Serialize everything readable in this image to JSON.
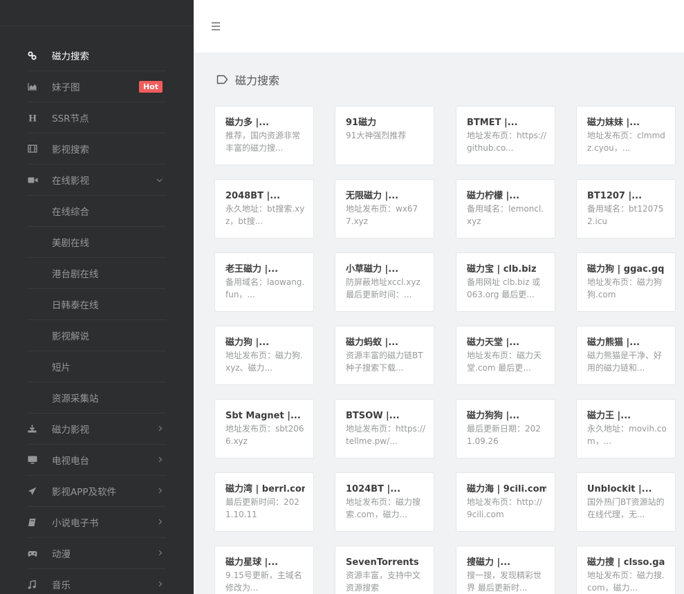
{
  "sidebar": {
    "items": [
      {
        "icon": "link-icon",
        "label": "磁力搜索",
        "active": true
      },
      {
        "icon": "area-chart-icon",
        "label": "妹子图",
        "badge": "Hot"
      },
      {
        "icon": "h-icon",
        "label": "SSR节点"
      },
      {
        "icon": "film-icon",
        "label": "影视搜索"
      },
      {
        "icon": "video-camera-icon",
        "label": "在线影视",
        "expanded": true
      },
      {
        "label": "在线综合",
        "sub": true
      },
      {
        "label": "美剧在线",
        "sub": true
      },
      {
        "label": "港台剧在线",
        "sub": true
      },
      {
        "label": "日韩泰在线",
        "sub": true
      },
      {
        "label": "影视解说",
        "sub": true
      },
      {
        "label": "短片",
        "sub": true
      },
      {
        "label": "资源采集站",
        "sub": true
      },
      {
        "icon": "download-icon",
        "label": "磁力影视",
        "arrow": true
      },
      {
        "icon": "monitor-icon",
        "label": "电视电台",
        "arrow": true
      },
      {
        "icon": "rocket-icon",
        "label": "影视APP及软件",
        "arrow": true
      },
      {
        "icon": "book-icon",
        "label": "小说电子书",
        "arrow": true
      },
      {
        "icon": "gamepad-icon",
        "label": "动漫",
        "arrow": true
      },
      {
        "icon": "music-icon",
        "label": "音乐",
        "arrow": true
      }
    ]
  },
  "header": {
    "menu_icon": "hamburger-icon"
  },
  "section": {
    "icon": "tag-icon",
    "title": "磁力搜索"
  },
  "cards": [
    {
      "title": "磁力多 |...",
      "desc": "推荐，国内资源非常丰富的磁力搜..."
    },
    {
      "title": "91磁力",
      "desc": "91大神强烈推荐"
    },
    {
      "title": "BTMET |...",
      "desc": "地址发布页：https://github.co..."
    },
    {
      "title": "磁力妹妹 |...",
      "desc": "地址发布页：clmmdz.cyou，..."
    },
    {
      "title": "2048BT |...",
      "desc": "永久地址：bt搜索.xyz，bt搜..."
    },
    {
      "title": "无限磁力 |...",
      "desc": "地址发布页：wx677.xyz"
    },
    {
      "title": "磁力柠檬 |...",
      "desc": "备用域名：lemoncl.xyz"
    },
    {
      "title": "BT1207 |...",
      "desc": "备用域名：bt120752.icu"
    },
    {
      "title": "老王磁力 |...",
      "desc": "备用域名：laowang.fun，..."
    },
    {
      "title": "小草磁力 |...",
      "desc": "防屏蔽地址xccl.xyz 最后更新时间：..."
    },
    {
      "title": "磁力宝 | clb.biz",
      "desc": "备用网址 clb.biz 或 063.org 最后更..."
    },
    {
      "title": "磁力狗 | ggac.gq",
      "desc": "地址发布页：磁力狗狗.com"
    },
    {
      "title": "磁力狗 |...",
      "desc": "地址发布页：磁力狗.xyz、磁力..."
    },
    {
      "title": "磁力蚂蚁 |...",
      "desc": "资源丰富的磁力链BT种子搜索下载..."
    },
    {
      "title": "磁力天堂 |...",
      "desc": "地址发布页：磁力天堂.com 最后更..."
    },
    {
      "title": "磁力熊猫 |...",
      "desc": "磁力熊猫是干净、好用的磁力链和..."
    },
    {
      "title": "Sbt Magnet |...",
      "desc": "地址发布页：sbt2066.xyz"
    },
    {
      "title": "BTSOW |...",
      "desc": "地址发布页：https://tellme.pw/..."
    },
    {
      "title": "磁力狗狗 |...",
      "desc": "最后更新日期：2021.09.26"
    },
    {
      "title": "磁力王 |...",
      "desc": "永久地址：movih.com，..."
    },
    {
      "title": "磁力湾 | berrl.com",
      "desc": "最后更新时间：2021.10.11"
    },
    {
      "title": "1024BT |...",
      "desc": "地址发布页：磁力搜索.com，磁力..."
    },
    {
      "title": "磁力海 | 9cili.com",
      "desc": "地址发布页：http://9cili.com"
    },
    {
      "title": "Unblockit |...",
      "desc": "国外热门BT资源站的在线代理，无..."
    },
    {
      "title": "磁力星球 |...",
      "desc": "9.15号更新，主域名修改为..."
    },
    {
      "title": "SevenTorrents",
      "desc": "资源丰富，支持中文资源搜索"
    },
    {
      "title": "搜磁力 |...",
      "desc": "搜一搜，发现精彩世界 最后更新时..."
    },
    {
      "title": "磁力搜 | clsso.ga",
      "desc": "地址发布页：磁力搜.com，磁力..."
    }
  ]
}
